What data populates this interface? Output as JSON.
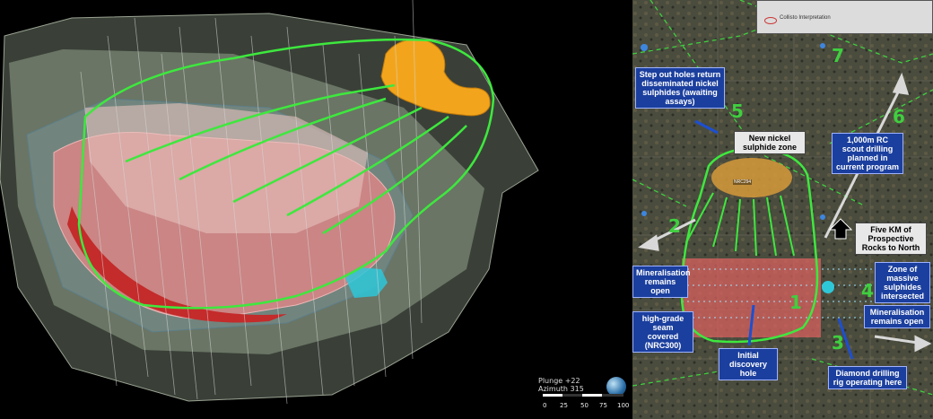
{
  "colors": {
    "trace_green": "#3ee83e",
    "label_blue": "#1b3f9e",
    "massive_red": "#d9605f",
    "sulphide_orange": "#f2a51c",
    "cyan_zone": "#2ec7d8"
  },
  "viewer": {
    "plunge": "Plunge +22",
    "azimuth": "Azimuth 315",
    "scale_ticks": [
      "0",
      "25",
      "50",
      "75",
      "100"
    ],
    "globe_icon": "globe-icon"
  },
  "map": {
    "legend": {
      "item_2": "Collisto Interpretation"
    },
    "numbers": [
      "1",
      "2",
      "3",
      "4",
      "5",
      "6",
      "7"
    ],
    "labels": {
      "step_out": "Step out holes return disseminated nickel sulphides (awaiting assays)",
      "new_nickel": "New nickel sulphide zone",
      "rc_scout": "1,000m RC scout drilling planned in current program",
      "five_km": "Five KM of Prospective Rocks to North",
      "mineralisation_left": "Mineralisation remains open",
      "high_grade": "high-grade seam covered (NRC300)",
      "initial_discovery": "Initial discovery hole",
      "zone_massive": "Zone of massive sulphides intersected",
      "mineralisation_right": "Mineralisation remains open",
      "diamond_rig": "Diamond drilling rig operating here"
    },
    "hole_tags": [
      "NRC294"
    ]
  }
}
